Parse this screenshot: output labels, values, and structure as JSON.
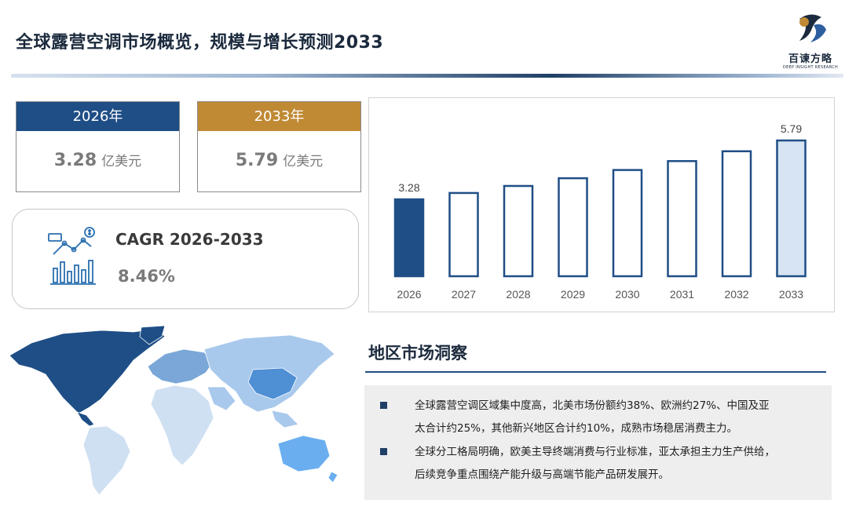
{
  "header": {
    "title": "全球露营空调市场概览，规模与增长预测2033",
    "logo_name": "百谏方略",
    "logo_sub": "DEEP INSIGHT RESEARCH"
  },
  "kpis": {
    "start": {
      "year_label": "2026年",
      "value": "3.28",
      "unit": "亿美元"
    },
    "end": {
      "year_label": "2033年",
      "value": "5.79",
      "unit": "亿美元"
    },
    "cagr": {
      "label": "CAGR 2026-2033",
      "value": "8.46%"
    }
  },
  "chart_data": {
    "type": "bar",
    "categories": [
      "2026",
      "2027",
      "2028",
      "2029",
      "2030",
      "2031",
      "2032",
      "2033"
    ],
    "values": [
      3.28,
      3.55,
      3.85,
      4.18,
      4.53,
      4.91,
      5.33,
      5.79
    ],
    "data_labels": {
      "2026": "3.28",
      "2033": "5.79"
    },
    "ylim": [
      0,
      5.79
    ],
    "grid": false,
    "colors": {
      "first": "#1f4e86",
      "last_fill": "#d6e4f3",
      "outline": "#1f4e86",
      "middle_fill": "#ffffff"
    }
  },
  "region": {
    "title": "地区市场洞察",
    "points": [
      {
        "lines": [
          "全球露营空调区域集中度高，北美市场份额约38%、欧洲约27%、中国及亚",
          "太合计约25%，其他新兴地区合计约10%，成熟市场稳居消费主力。"
        ]
      },
      {
        "lines": [
          "全球分工格局明确，欧美主导终端消费与行业标准，亚太承担主力生产供给，",
          "后续竞争重点围绕产能升级与高端节能产品研发展开。"
        ]
      }
    ]
  },
  "map": {
    "colors": {
      "north_america": "#1f4e86",
      "europe": "#7aa7d8",
      "asia": "#a9c9ec",
      "oceania": "#6aaef0",
      "south_america": "#cfe0f2",
      "africa": "#cfe0f2"
    }
  }
}
